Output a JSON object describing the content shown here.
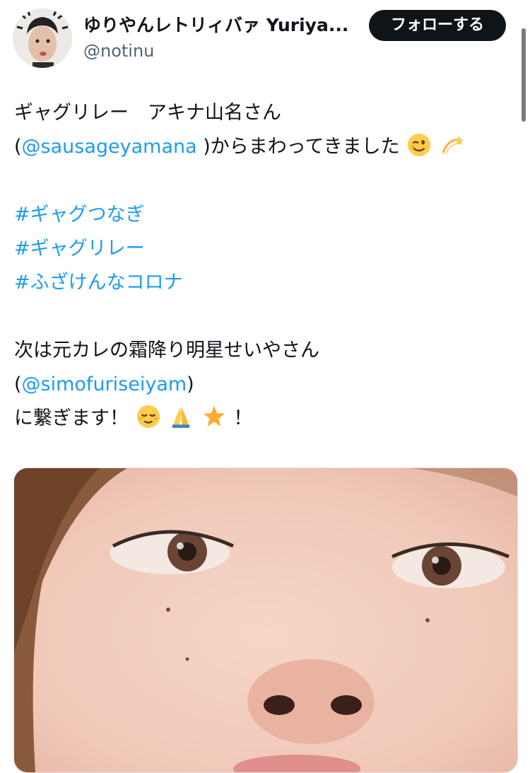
{
  "account": {
    "display_name": "ゆりやんレトリィバァ Yuriya...",
    "handle": "@notinu"
  },
  "follow_button": {
    "label": "フォローする"
  },
  "tweet": {
    "line1": "ギャグリレー　アキナ山名さん",
    "line2_open": "(",
    "line2_mention": "@sausageyamana",
    "line2_rest": " )からまわってきました",
    "hashtags": [
      "#ギャグつなぎ",
      "#ギャグリレー",
      "#ふざけんなコロナ"
    ],
    "line6": "次は元カレの霜降り明星せいやさん",
    "line7_open": "(",
    "line7_mention": "@simofuriseiyam",
    "line7_close": ")",
    "line8_start": "に繋ぎます！",
    "line8_end": "！",
    "emojis": [
      "winking-face",
      "dizzy",
      "relieved-face",
      "folded-hands",
      "star"
    ]
  },
  "colors": {
    "link": "#1d9bf0",
    "text": "#0f1419",
    "secondary": "#536471",
    "button_bg": "#0f1419"
  }
}
